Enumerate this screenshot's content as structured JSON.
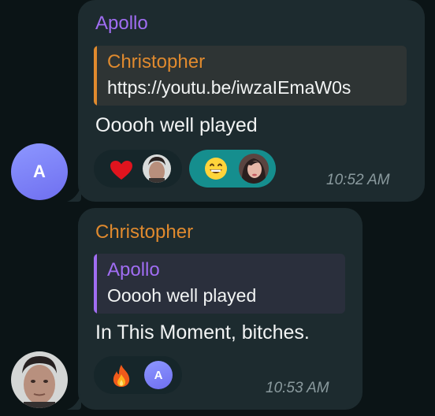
{
  "colors": {
    "background": "#0b1416",
    "bubble": "#1d2b2f",
    "apollo_name": "#a06df2",
    "christopher_name": "#e08a2e",
    "reaction_selected": "#158e8e"
  },
  "messages": [
    {
      "sender": "Apollo",
      "reply": {
        "name": "Christopher",
        "text": "https://youtu.be/iwzaIEmaW0s"
      },
      "text": "Ooooh well played",
      "time": "10:52 AM",
      "avatar_letter": "A",
      "reactions": [
        {
          "emoji": "red-heart-icon",
          "by": "christopher-avatar"
        },
        {
          "emoji": "grinning-face-icon",
          "by": "woman-avatar",
          "selected": true
        }
      ]
    },
    {
      "sender": "Christopher",
      "reply": {
        "name": "Apollo",
        "text": "Ooooh well played"
      },
      "text": "In This Moment, bitches.",
      "time": "10:53 AM",
      "reactions": [
        {
          "emoji": "fire-icon",
          "by_letter": "A"
        }
      ]
    }
  ]
}
